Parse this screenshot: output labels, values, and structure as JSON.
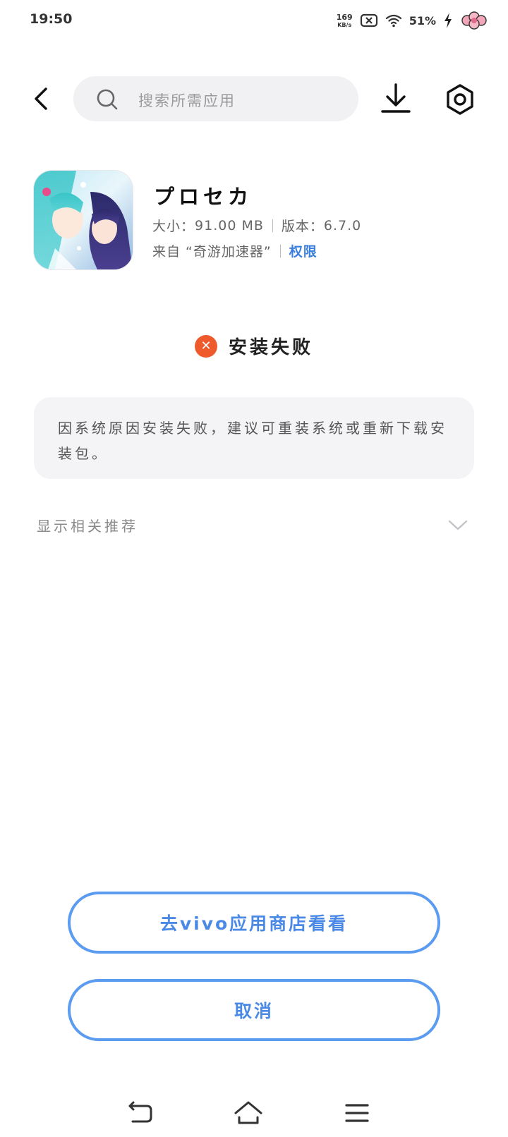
{
  "status_bar": {
    "time": "19:50",
    "net_speed_value": "169",
    "net_speed_unit": "KB/s",
    "battery": "51%",
    "icons": [
      "sim-x-icon",
      "wifi-icon",
      "charging-bolt-icon",
      "flower-sticker-icon"
    ]
  },
  "header": {
    "search_placeholder": "搜索所需应用",
    "icons": [
      "back-arrow-icon",
      "search-icon",
      "download-icon",
      "settings-hexagon-icon"
    ]
  },
  "app": {
    "name": "プロセカ",
    "size_label": "大小：",
    "size_value": "91.00 MB",
    "version_label": "版本：",
    "version_value": "6.7.0",
    "source_text": "来自 “奇游加速器”",
    "permission_link": "权限"
  },
  "status": {
    "text": "安装失败",
    "icon": "error-x-icon",
    "color": "#ef5a2c"
  },
  "message": {
    "text": "因系统原因安装失败，建议可重装系统或重新下载安装包。"
  },
  "recommend": {
    "label": "显示相关推荐",
    "icon": "chevron-down-icon"
  },
  "buttons": {
    "store": "去vivo应用商店看看",
    "cancel": "取消",
    "accent": "#5b9bf0"
  },
  "navbar": {
    "icons": [
      "back-nav-icon",
      "home-nav-icon",
      "menu-nav-icon"
    ]
  }
}
